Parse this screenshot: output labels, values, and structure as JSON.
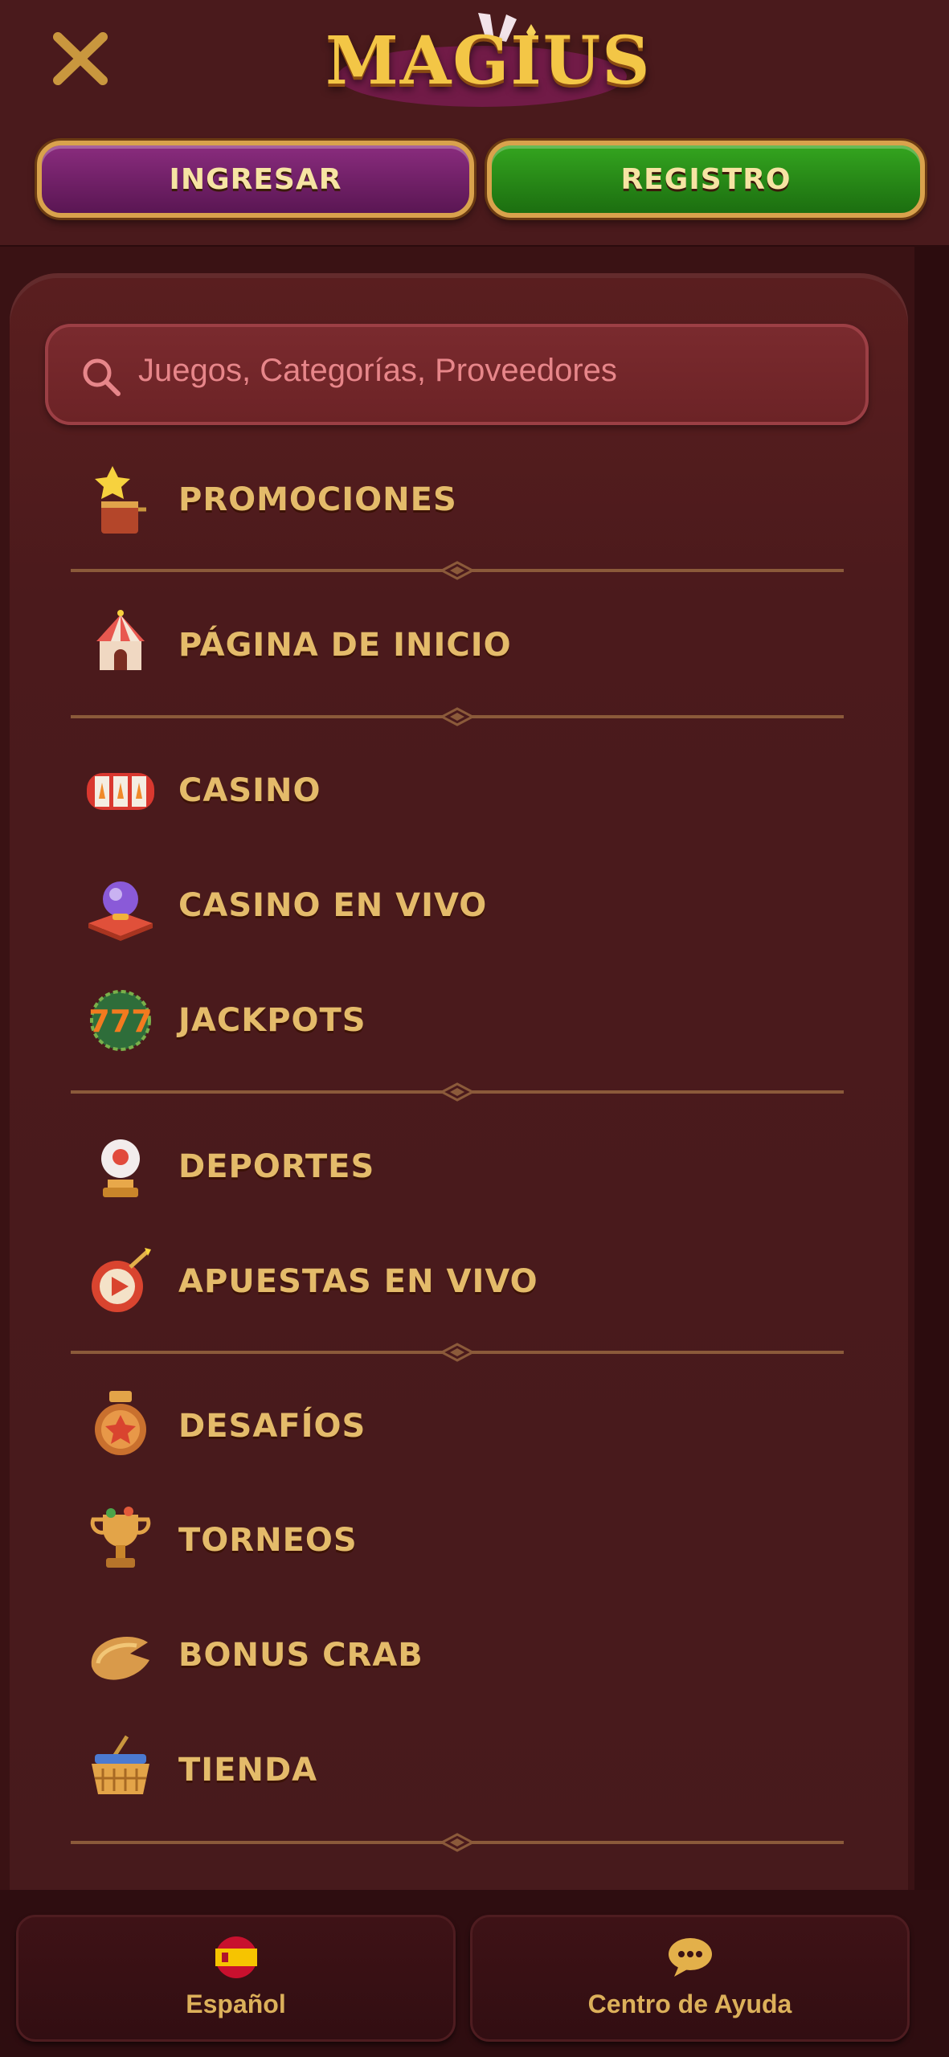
{
  "header": {
    "logo_text": "MAGIUS",
    "login_label": "INGRESAR",
    "register_label": "REGISTRO"
  },
  "search": {
    "placeholder": "Juegos, Categorías, Proveedores"
  },
  "menu": {
    "items": [
      {
        "label": "PROMOCIONES",
        "icon": "jack-in-the-box-star-icon"
      },
      {
        "label": "PÁGINA DE INICIO",
        "icon": "circus-tent-icon"
      },
      {
        "label": "CASINO",
        "icon": "slot-reels-icon"
      },
      {
        "label": "CASINO EN VIVO",
        "icon": "crystal-ball-icon"
      },
      {
        "label": "JACKPOTS",
        "icon": "lucky-777-icon"
      },
      {
        "label": "DEPORTES",
        "icon": "sports-ball-trophy-icon"
      },
      {
        "label": "APUESTAS EN VIVO",
        "icon": "dartboard-play-icon"
      },
      {
        "label": "DESAFÍOS",
        "icon": "star-medal-icon"
      },
      {
        "label": "TORNEOS",
        "icon": "trophy-cup-icon"
      },
      {
        "label": "BONUS CRAB",
        "icon": "crab-claw-icon"
      },
      {
        "label": "TIENDA",
        "icon": "shopping-basket-icon"
      }
    ]
  },
  "footer": {
    "language_label": "Español",
    "help_label": "Centro de Ayuda"
  },
  "colors": {
    "background": "#4a1a1c",
    "gold_text": "#e4bb6a",
    "login_purple": "#7a2470",
    "register_green": "#27891a",
    "search_placeholder": "#e7868a"
  }
}
